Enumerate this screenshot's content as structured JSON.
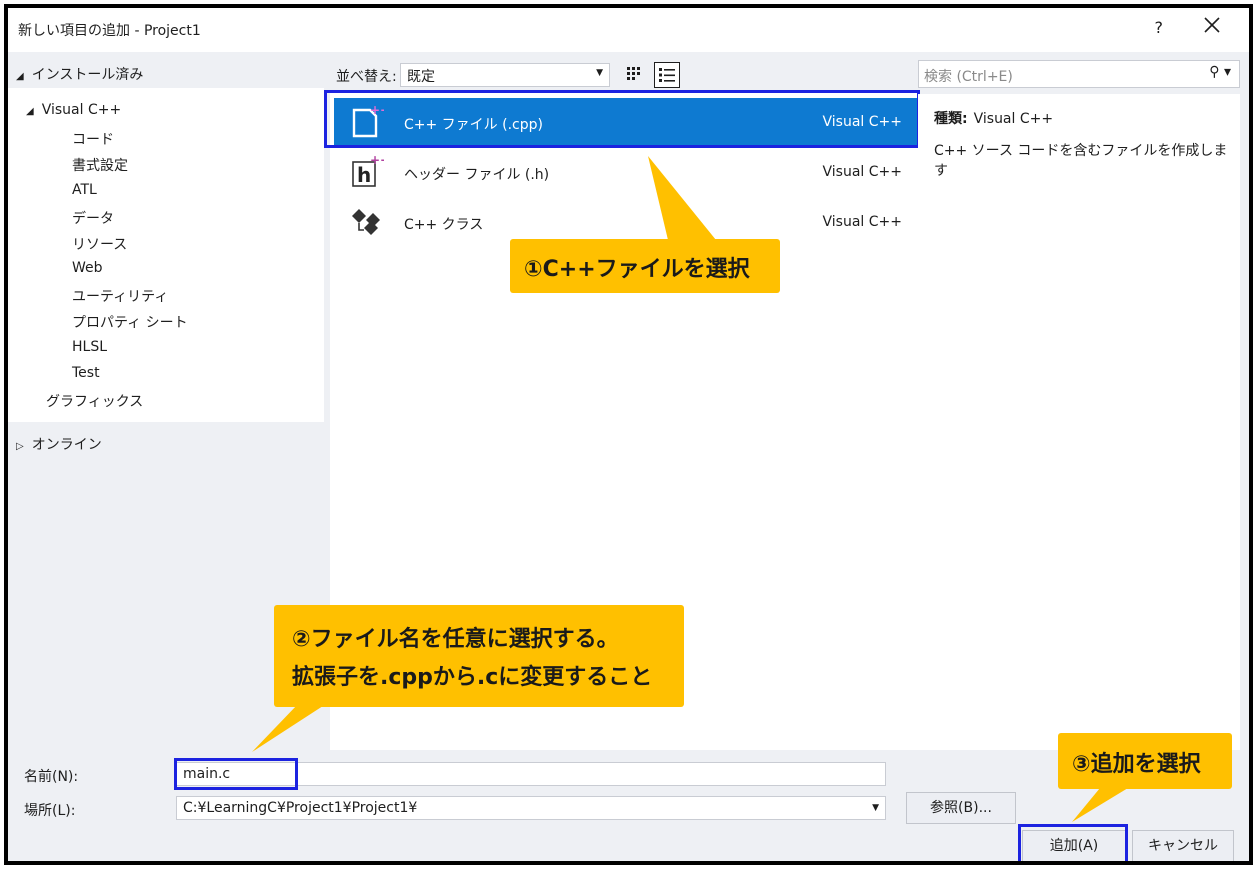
{
  "window": {
    "title": "新しい項目の追加 - Project1",
    "help": "?",
    "close": "✕"
  },
  "left": {
    "installed": "インストール済み",
    "tree": [
      "Visual C++",
      "コード",
      "書式設定",
      "ATL",
      "データ",
      "リソース",
      "Web",
      "ユーティリティ",
      "プロパティ シート",
      "HLSL",
      "Test",
      "グラフィックス"
    ],
    "online": "オンライン"
  },
  "toolbar": {
    "sort_label": "並べ替え:",
    "sort_value": "既定"
  },
  "templates": [
    {
      "name": "C++ ファイル (.cpp)",
      "lang": "Visual C++"
    },
    {
      "name": "ヘッダー ファイル (.h)",
      "lang": "Visual C++"
    },
    {
      "name": "C++ クラス",
      "lang": "Visual C++"
    }
  ],
  "search": {
    "placeholder": "検索 (Ctrl+E)"
  },
  "description": {
    "type_label": "種類:",
    "type_value": "Visual C++",
    "text": "C++ ソース コードを含むファイルを作成します"
  },
  "form": {
    "name_label": "名前(N):",
    "name_value": "main.c",
    "location_label": "場所(L):",
    "location_value": "C:¥LearningC¥Project1¥Project1¥",
    "browse": "参照(B)...",
    "add": "追加(A)",
    "cancel": "キャンセル"
  },
  "callouts": {
    "one": "①C++ファイルを選択",
    "two_line1": "②ファイル名を任意に選択する。",
    "two_line2": "拡張子を.cppから.cに変更すること",
    "three": "③追加を選択"
  },
  "colors": {
    "selection": "#0e7ad1",
    "callout": "#ffc000",
    "highlight": "#1c23e0"
  }
}
